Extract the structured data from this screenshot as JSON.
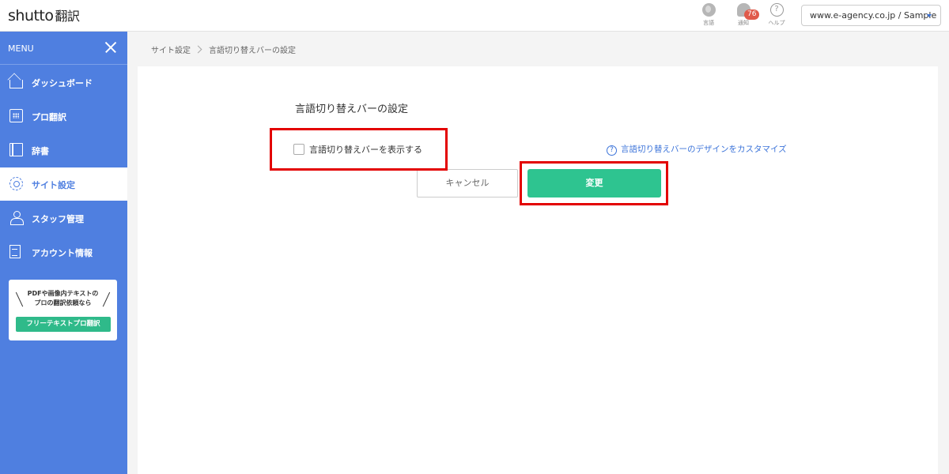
{
  "header": {
    "logo": "shutto",
    "logo_jp": "翻訳",
    "language_label": "言語",
    "notification_label": "通知",
    "notification_count": "76",
    "help_label": "ヘルプ",
    "help_glyph": "?",
    "site_selector_value": "www.e-agency.co.jp / Sample"
  },
  "sidebar": {
    "menu_label": "MENU",
    "items": [
      {
        "label": "ダッシュボード",
        "icon": "home-icon"
      },
      {
        "label": "プロ翻訳",
        "icon": "calendar-icon"
      },
      {
        "label": "辞書",
        "icon": "book-icon"
      },
      {
        "label": "サイト設定",
        "icon": "gear-icon",
        "active": true
      },
      {
        "label": "スタッフ管理",
        "icon": "staff-icon"
      },
      {
        "label": "アカウント情報",
        "icon": "document-icon"
      }
    ],
    "promo": {
      "line1": "PDFや画像内テキストの",
      "line2": "プロの翻訳依頼なら",
      "button": "フリーテキストプロ翻訳"
    }
  },
  "breadcrumb": {
    "parent": "サイト設定",
    "current": "言語切り替えバーの設定"
  },
  "main": {
    "section_title": "言語切り替えバーの設定",
    "checkbox_label": "言語切り替えバーを表示する",
    "checkbox_checked": false,
    "customize_glyph": "?",
    "customize_link": "言語切り替えバーのデザインをカスタマイズ",
    "cancel_button": "キャンセル",
    "change_button": "変更"
  },
  "colors": {
    "sidebar": "#4f7fe0",
    "primary_button": "#2ec490",
    "highlight": "#e30000",
    "link": "#3b73d9"
  }
}
